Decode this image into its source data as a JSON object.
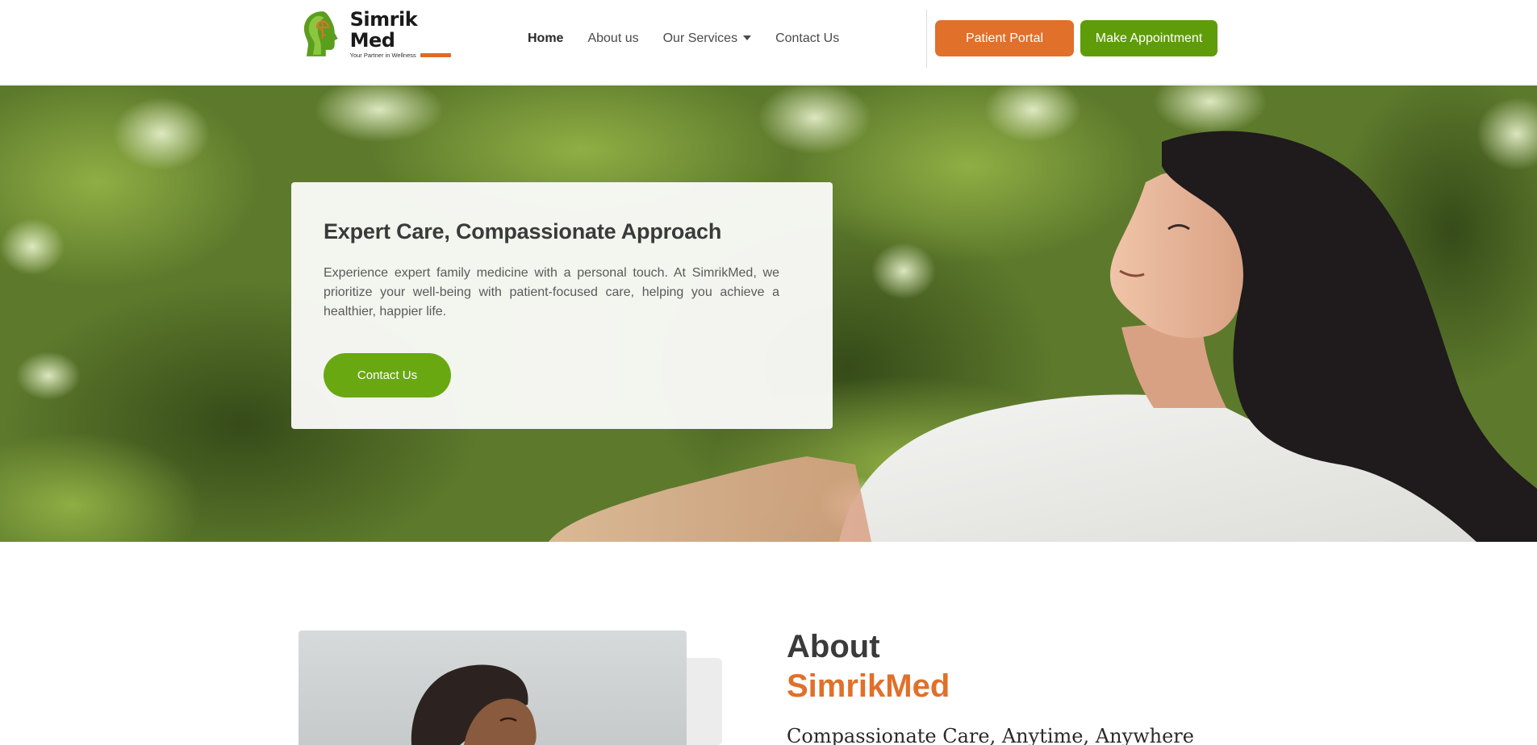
{
  "brand": {
    "name_part1": "Simrik",
    "name_part2": "Med",
    "tagline": "Your Partner in Wellness",
    "colors": {
      "orange": "#e0702a",
      "green": "#5f9c0a",
      "text": "#3a3a3a"
    }
  },
  "nav": {
    "items": [
      {
        "label": "Home",
        "active": true
      },
      {
        "label": "About us",
        "active": false
      },
      {
        "label": "Our Services",
        "active": false,
        "has_dropdown": true
      },
      {
        "label": "Contact Us",
        "active": false
      }
    ]
  },
  "header_buttons": {
    "portal": "Patient Portal",
    "appointment": "Make Appointment"
  },
  "hero": {
    "title": "Expert Care, Compassionate Approach",
    "text": "Experience expert family medicine with a personal touch. At SimrikMed, we prioritize your well-being with patient-focused care, helping you achieve a healthier, happier life.",
    "cta": "Contact Us",
    "image": "smiling-woman-outdoors-photo"
  },
  "about": {
    "title": "About",
    "brand": "SimrikMed",
    "subtitle": "Compassionate Care, Anytime, Anywhere",
    "image": "woman-looking-up-photo"
  }
}
